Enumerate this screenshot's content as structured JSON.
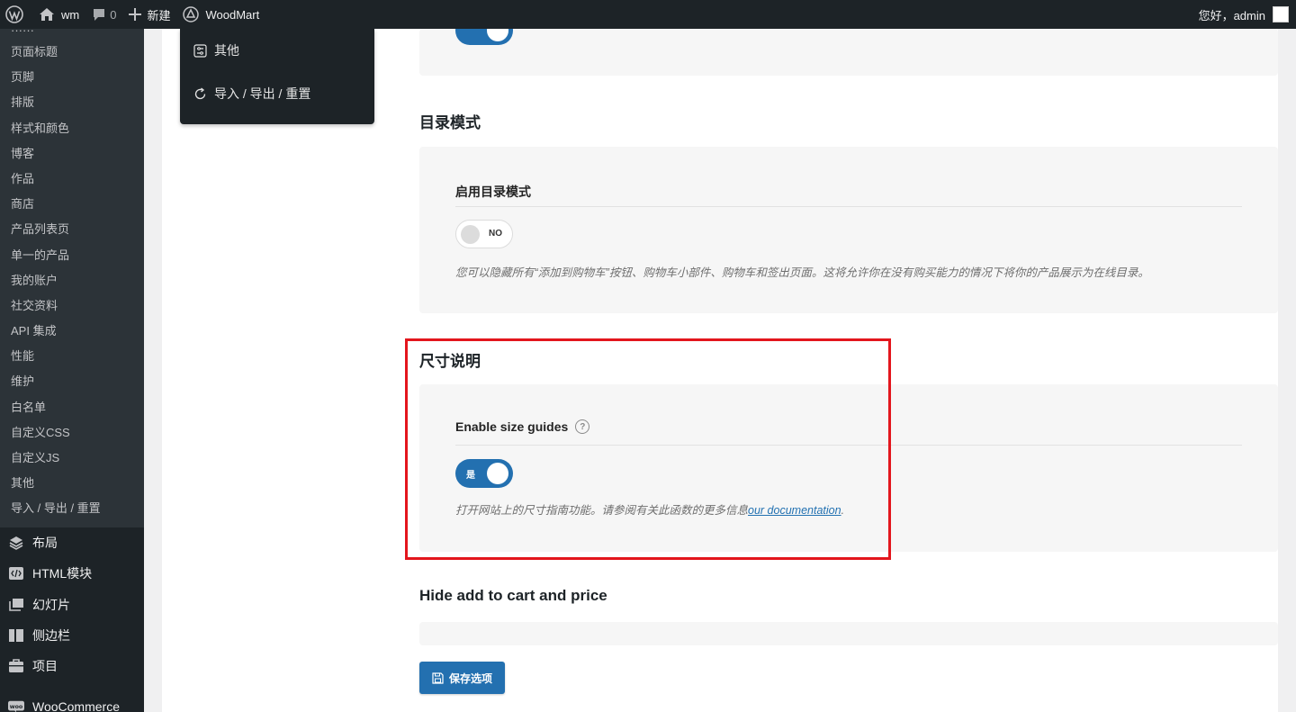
{
  "adminbar": {
    "site_name": "wm",
    "comments_count": "0",
    "new_label": "新建",
    "theme_label": "WoodMart",
    "greeting": "您好，admin"
  },
  "sidebar": {
    "submenu": [
      "页面标题",
      "页脚",
      "排版",
      "样式和颜色",
      "博客",
      "作品",
      "商店",
      "产品列表页",
      "单一的产品",
      "我的账户",
      "社交资料",
      "API 集成",
      "性能",
      "维护",
      "白名单",
      "自定义CSS",
      "自定义JS",
      "其他",
      "导入 / 导出 / 重置"
    ],
    "menu": [
      {
        "label": "布局",
        "icon": "layers-icon"
      },
      {
        "label": "HTML模块",
        "icon": "code-block-icon"
      },
      {
        "label": "幻灯片",
        "icon": "slides-icon"
      },
      {
        "label": "侧边栏",
        "icon": "sidebar-icon"
      },
      {
        "label": "项目",
        "icon": "briefcase-icon"
      },
      {
        "label": "WooCommerce",
        "icon": "woo-icon"
      }
    ]
  },
  "options_nav": {
    "items": [
      {
        "label": "其他",
        "icon": "sliders-icon"
      },
      {
        "label": "导入 / 导出 / 重置",
        "icon": "refresh-icon"
      }
    ]
  },
  "catalog_mode": {
    "section_title": "目录模式",
    "field_title": "启用目录模式",
    "toggle_label": "NO",
    "toggle_on": false,
    "hint": "您可以隐藏所有“添加到购物车”按钮、购物车小部件、购物车和签出页面。这将允许你在没有购买能力的情况下将你的产品展示为在线目录。"
  },
  "size_guides": {
    "section_title": "尺寸说明",
    "field_title": "Enable size guides",
    "help_symbol": "?",
    "toggle_label": "是",
    "toggle_on": true,
    "hint": "打开网站上的尺寸指南功能。请参阅有关此函数的更多信息",
    "link_text": "our documentation",
    "hint_end": "."
  },
  "hide_cart": {
    "section_title": "Hide add to cart and price"
  },
  "save_button": {
    "label": "保存选项"
  },
  "colors": {
    "accent": "#2370b0",
    "highlight": "#e3161d",
    "admin_dark": "#1d2327"
  }
}
